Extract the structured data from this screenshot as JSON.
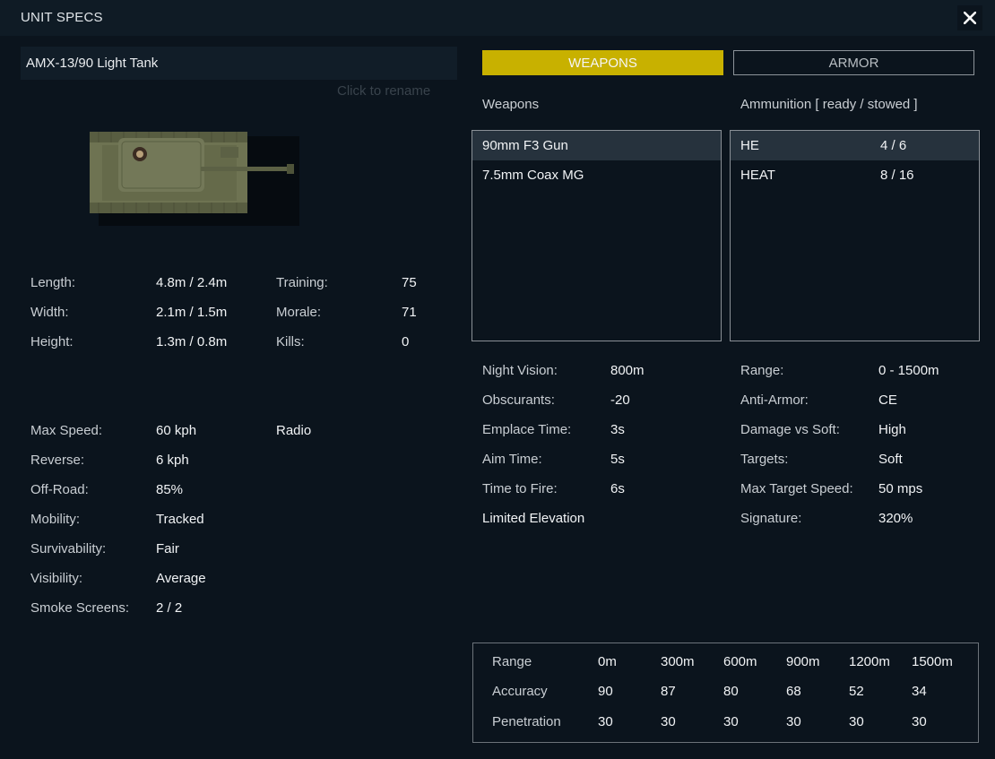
{
  "window": {
    "title": "UNIT SPECS"
  },
  "unit": {
    "name": "AMX-13/90 Light Tank",
    "rename_hint": "Click to rename"
  },
  "stats_top": [
    {
      "label": "Length:",
      "value": "4.8m / 2.4m"
    },
    {
      "label": "Width:",
      "value": "2.1m / 1.5m"
    },
    {
      "label": "Height:",
      "value": "1.3m / 0.8m"
    }
  ],
  "crew": [
    {
      "label": "Training:",
      "value": "75"
    },
    {
      "label": "Morale:",
      "value": "71"
    },
    {
      "label": "Kills:",
      "value": "0"
    }
  ],
  "mobility": [
    {
      "label": "Max Speed:",
      "value": "60 kph"
    },
    {
      "label": "Reverse:",
      "value": "6 kph"
    },
    {
      "label": "Off-Road:",
      "value": "85%"
    },
    {
      "label": "Mobility:",
      "value": "Tracked"
    },
    {
      "label": "Survivability:",
      "value": "Fair"
    },
    {
      "label": "Visibility:",
      "value": "Average"
    },
    {
      "label": "Smoke Screens:",
      "value": "2 / 2"
    }
  ],
  "features": [
    "Radio"
  ],
  "tabs": {
    "weapons": "WEAPONS",
    "armor": "ARMOR"
  },
  "weapons_header": "Weapons",
  "ammo_header": "Ammunition [ ready / stowed ]",
  "weapons": [
    "90mm F3 Gun",
    "7.5mm Coax MG"
  ],
  "ammunition": [
    {
      "type": "HE",
      "count": "4 / 6"
    },
    {
      "type": "HEAT",
      "count": "8 / 16"
    }
  ],
  "weapon_stats": [
    {
      "label": "Night Vision:",
      "value": "800m"
    },
    {
      "label": "Obscurants:",
      "value": "-20"
    },
    {
      "label": "Emplace Time:",
      "value": "3s"
    },
    {
      "label": "Aim Time:",
      "value": "5s"
    },
    {
      "label": "Time to Fire:",
      "value": "6s"
    }
  ],
  "weapon_note": "Limited Elevation",
  "ammo_stats": [
    {
      "label": "Range:",
      "value": "0 - 1500m"
    },
    {
      "label": "Anti-Armor:",
      "value": "CE"
    },
    {
      "label": "Damage vs Soft:",
      "value": "High"
    },
    {
      "label": "Targets:",
      "value": "Soft"
    },
    {
      "label": "Max Target Speed:",
      "value": "50 mps"
    },
    {
      "label": "Signature:",
      "value": "320%"
    }
  ],
  "range_table": {
    "rows": [
      {
        "label": "Range",
        "values": [
          "0m",
          "300m",
          "600m",
          "900m",
          "1200m",
          "1500m"
        ]
      },
      {
        "label": "Accuracy",
        "values": [
          "90",
          "87",
          "80",
          "68",
          "52",
          "34"
        ]
      },
      {
        "label": "Penetration",
        "values": [
          "30",
          "30",
          "30",
          "30",
          "30",
          "30"
        ]
      }
    ]
  },
  "colors": {
    "background": "#0b141d",
    "accent": "#c8b100",
    "selected_row": "#26323d"
  }
}
